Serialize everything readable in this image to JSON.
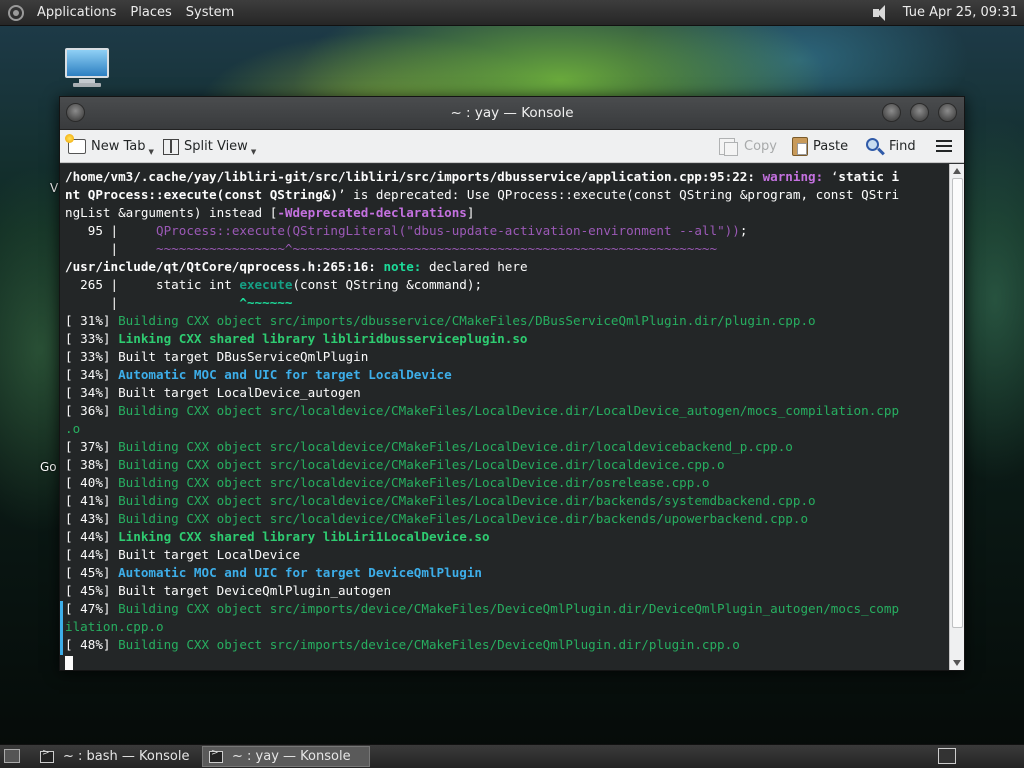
{
  "top_panel": {
    "menus": [
      "Applications",
      "Places",
      "System"
    ],
    "clock": "Tue Apr 25, 09:31"
  },
  "desktop": {
    "label_partial_1": "V",
    "label_partial_2": "Go"
  },
  "window": {
    "title": "~ : yay — Konsole",
    "toolbar": {
      "new_tab": "New Tab",
      "split_view": "Split View",
      "copy": "Copy",
      "paste": "Paste",
      "find": "Find"
    }
  },
  "terminal": {
    "lines": [
      [
        [
          "bold",
          "/home/vm3/.cache/yay/libliri-git/src/libliri/src/imports/dbusservice/application.cpp:95:22: "
        ],
        [
          "c-warn",
          "warning: "
        ],
        [
          "",
          "‘"
        ],
        [
          "bold",
          "static i"
        ]
      ],
      [
        [
          "bold",
          "nt QProcess::execute(const QString&)"
        ],
        [
          "",
          "’ is deprecated: Use QProcess::execute(const QString &program, const QStri"
        ]
      ],
      [
        [
          "",
          "ngList &arguments) instead ["
        ],
        [
          "c-warn",
          "-Wdeprecated-declarations"
        ],
        [
          "",
          "]"
        ]
      ],
      [
        [
          "",
          "   95 |     "
        ],
        [
          "c-purple",
          "QProcess::execute(QStringLiteral(\"dbus-update-activation-environment --all\"))"
        ],
        [
          "",
          ";"
        ]
      ],
      [
        [
          "",
          "      |     "
        ],
        [
          "c-purple",
          "~~~~~~~~~~~~~~~~~^~~~~~~~~~~~~~~~~~~~~~~~~~~~~~~~~~~~~~~~~~~~~~~~~~~~~~~~~"
        ]
      ],
      [
        [
          "bold",
          "/usr/include/qt/QtCore/qprocess.h:265:16: "
        ],
        [
          "c-gold",
          "note: "
        ],
        [
          "",
          "declared here"
        ]
      ],
      [
        [
          "",
          "  265 |     static int "
        ],
        [
          "c-teal",
          "execute"
        ],
        [
          "",
          "(const QString &command);"
        ]
      ],
      [
        [
          "",
          "      |                "
        ],
        [
          "c-gold",
          "^~~~~~~"
        ]
      ],
      [
        [
          "",
          "[ 31%] "
        ],
        [
          "c-green",
          "Building CXX object src/imports/dbusservice/CMakeFiles/DBusServiceQmlPlugin.dir/plugin.cpp.o"
        ]
      ],
      [
        [
          "",
          "[ 33%] "
        ],
        [
          "c-gbold",
          "Linking CXX shared library libliridbusserviceplugin.so"
        ]
      ],
      [
        [
          "",
          "[ 33%] Built target DBusServiceQmlPlugin"
        ]
      ],
      [
        [
          "",
          "[ 34%] "
        ],
        [
          "c-blue",
          "Automatic MOC and UIC for target LocalDevice"
        ]
      ],
      [
        [
          "",
          "[ 34%] Built target LocalDevice_autogen"
        ]
      ],
      [
        [
          "",
          "[ 36%] "
        ],
        [
          "c-green",
          "Building CXX object src/localdevice/CMakeFiles/LocalDevice.dir/LocalDevice_autogen/mocs_compilation.cpp"
        ]
      ],
      [
        [
          "c-green",
          ".o"
        ]
      ],
      [
        [
          "",
          "[ 37%] "
        ],
        [
          "c-green",
          "Building CXX object src/localdevice/CMakeFiles/LocalDevice.dir/localdevicebackend_p.cpp.o"
        ]
      ],
      [
        [
          "",
          "[ 38%] "
        ],
        [
          "c-green",
          "Building CXX object src/localdevice/CMakeFiles/LocalDevice.dir/localdevice.cpp.o"
        ]
      ],
      [
        [
          "",
          "[ 40%] "
        ],
        [
          "c-green",
          "Building CXX object src/localdevice/CMakeFiles/LocalDevice.dir/osrelease.cpp.o"
        ]
      ],
      [
        [
          "",
          "[ 41%] "
        ],
        [
          "c-green",
          "Building CXX object src/localdevice/CMakeFiles/LocalDevice.dir/backends/systemdbackend.cpp.o"
        ]
      ],
      [
        [
          "",
          "[ 43%] "
        ],
        [
          "c-green",
          "Building CXX object src/localdevice/CMakeFiles/LocalDevice.dir/backends/upowerbackend.cpp.o"
        ]
      ],
      [
        [
          "",
          "[ 44%] "
        ],
        [
          "c-gbold",
          "Linking CXX shared library libLiri1LocalDevice.so"
        ]
      ],
      [
        [
          "",
          "[ 44%] Built target LocalDevice"
        ]
      ],
      [
        [
          "",
          "[ 45%] "
        ],
        [
          "c-blue",
          "Automatic MOC and UIC for target DeviceQmlPlugin"
        ]
      ],
      [
        [
          "",
          "[ 45%] Built target DeviceQmlPlugin_autogen"
        ]
      ],
      [
        [
          "",
          "[ 47%] "
        ],
        [
          "c-green",
          "Building CXX object src/imports/device/CMakeFiles/DeviceQmlPlugin.dir/DeviceQmlPlugin_autogen/mocs_comp"
        ]
      ],
      [
        [
          "c-green",
          "ilation.cpp.o"
        ]
      ],
      [
        [
          "",
          "[ 48%] "
        ],
        [
          "c-green",
          "Building CXX object src/imports/device/CMakeFiles/DeviceQmlPlugin.dir/plugin.cpp.o"
        ]
      ]
    ]
  },
  "taskbar": {
    "tasks": [
      "~ : bash — Konsole",
      "~ : yay — Konsole"
    ]
  }
}
